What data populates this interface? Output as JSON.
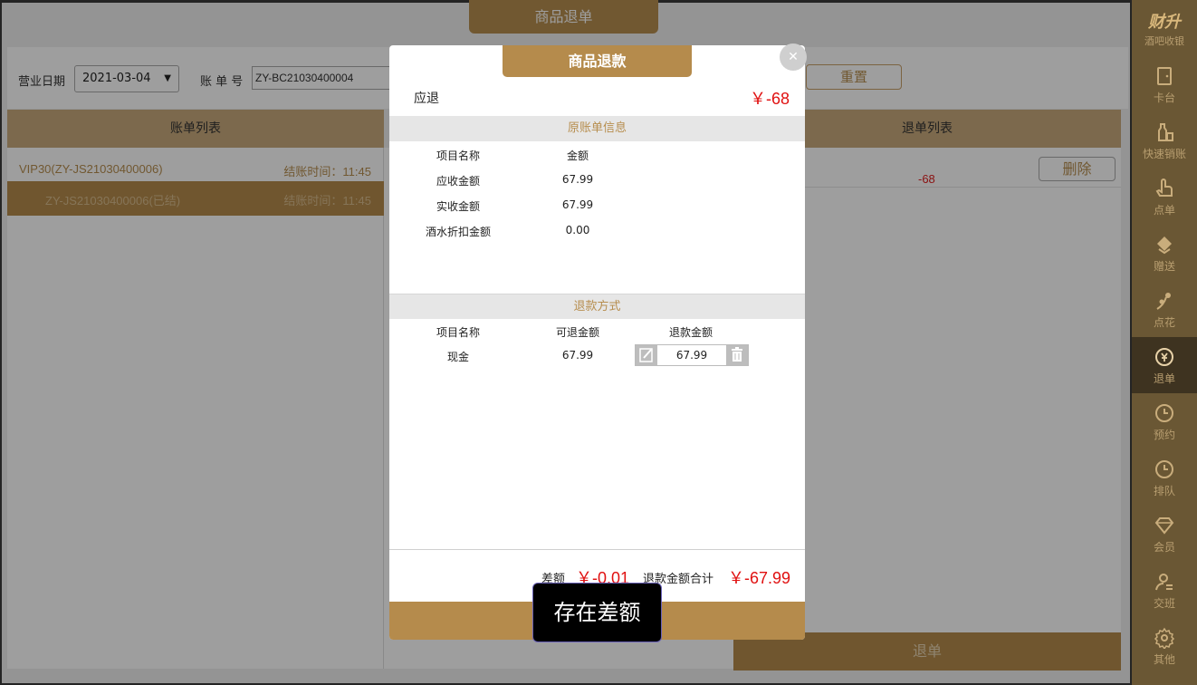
{
  "app": {
    "title": "商品退单"
  },
  "filter": {
    "date_label": "营业日期",
    "date_value": "2021-03-04",
    "bill_label": "账 单 号",
    "bill_value": "ZY-BC21030400004",
    "reset_label": "重置"
  },
  "bill_list": {
    "header": "账单列表",
    "rows": [
      {
        "name": "VIP30(ZY-JS21030400006)",
        "time": "结账时间：11:45"
      },
      {
        "name": "ZY-JS21030400006(已结)",
        "time": "结账时间：11:45"
      }
    ]
  },
  "refund_list": {
    "header": "退单列表",
    "rows": [
      {
        "amount": "-68",
        "delete_label": "删除"
      }
    ],
    "submit_label": "退单"
  },
  "sidebar": {
    "brand_title": "财升",
    "brand_subtitle": "酒吧收银",
    "items": [
      {
        "label": "卡台",
        "icon": "door-icon"
      },
      {
        "label": "快速销账",
        "icon": "bottle-icon"
      },
      {
        "label": "点单",
        "icon": "hand-pointer-icon"
      },
      {
        "label": "赠送",
        "icon": "gift-icon"
      },
      {
        "label": "点花",
        "icon": "flower-icon"
      },
      {
        "label": "退单",
        "icon": "refund-yen-icon",
        "active": true
      },
      {
        "label": "预约",
        "icon": "clock-icon"
      },
      {
        "label": "排队",
        "icon": "clock-icon"
      },
      {
        "label": "会员",
        "icon": "diamond-icon"
      },
      {
        "label": "交班",
        "icon": "user-handover-icon"
      },
      {
        "label": "其他",
        "icon": "gear-icon"
      }
    ]
  },
  "dialog": {
    "title": "商品退款",
    "due_label": "应退",
    "due_value": "￥-68",
    "original": {
      "header": "原账单信息",
      "columns": [
        "项目名称",
        "金额"
      ],
      "rows": [
        {
          "name": "应收金额",
          "amount": "67.99"
        },
        {
          "name": "实收金额",
          "amount": "67.99"
        },
        {
          "name": "酒水折扣金额",
          "amount": "0.00"
        }
      ]
    },
    "method": {
      "header": "退款方式",
      "columns": [
        "项目名称",
        "可退金额",
        "退款金额"
      ],
      "rows": [
        {
          "name": "现金",
          "refundable": "67.99",
          "refund": "67.99"
        }
      ]
    },
    "footer": {
      "diff_label": "差额",
      "diff_value": "￥-0.01",
      "total_label": "退款金额合计",
      "total_value": "￥-67.99"
    }
  },
  "toast": {
    "text": "存在差额"
  },
  "colors": {
    "accent": "#b58b4c",
    "alert": "#e01010",
    "sidebar": "#6a5734"
  }
}
